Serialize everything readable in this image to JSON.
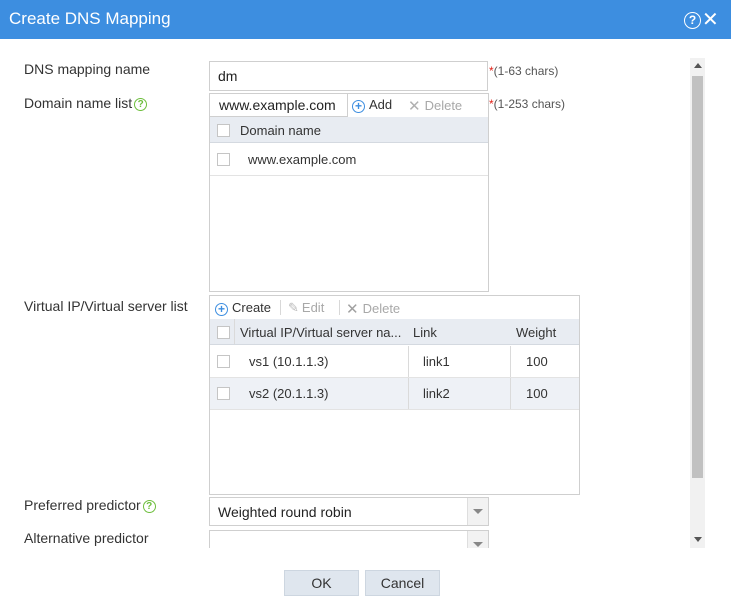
{
  "dialog": {
    "title": "Create DNS Mapping",
    "help_glyph": "?",
    "close_glyph": "✕"
  },
  "form": {
    "mapping_name": {
      "label": "DNS mapping name",
      "value": "dm",
      "hint_star": "*",
      "hint": "(1-63 chars)"
    },
    "domain_list": {
      "label": "Domain name list",
      "entry_value": "www.example.com",
      "add_label": "Add",
      "delete_label": "Delete",
      "hint_star": "*",
      "hint": "(1-253 chars)",
      "column_header": "Domain name",
      "rows": [
        "www.example.com"
      ]
    },
    "vip_list": {
      "label": "Virtual IP/Virtual server list",
      "create_label": "Create",
      "edit_label": "Edit",
      "delete_label": "Delete",
      "columns": [
        "Virtual IP/Virtual server na...",
        "Link",
        "Weight"
      ],
      "rows": [
        {
          "server": "vs1 (10.1.1.3)",
          "link": "link1",
          "weight": "100"
        },
        {
          "server": "vs2 (20.1.1.3)",
          "link": "link2",
          "weight": "100"
        }
      ]
    },
    "preferred_predictor": {
      "label": "Preferred predictor",
      "value": "Weighted round robin"
    },
    "alternative_predictor": {
      "label": "Alternative predictor",
      "value": ""
    }
  },
  "footer": {
    "ok_label": "OK",
    "cancel_label": "Cancel"
  },
  "colors": {
    "title_bar": "#3d8ee0",
    "help_green": "#6dbe3c",
    "required_red": "#e2231a",
    "button_bg": "#dfe6ee"
  },
  "icons": {
    "help": "help-circle-icon",
    "close": "close-icon",
    "add": "plus-circle-icon",
    "delete": "x-icon",
    "edit": "pencil-icon",
    "dropdown": "chevron-down-icon"
  }
}
